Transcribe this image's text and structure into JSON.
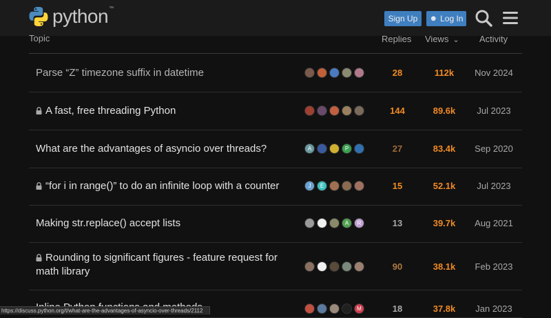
{
  "header": {
    "logo_text": "python",
    "logo_tm": "™",
    "signup_label": "Sign Up",
    "login_label": "Log In"
  },
  "columns": {
    "topic": "Topic",
    "replies": "Replies",
    "views": "Views",
    "activity": "Activity"
  },
  "topics": [
    {
      "title": "Parse “Z” timezone suffix in datetime",
      "locked": false,
      "muted": true,
      "replies": "28",
      "views": "112k",
      "activity": "Nov 2024",
      "replies_color": "#f08a24",
      "views_color": "#f08a24"
    },
    {
      "title": "A fast, free threading Python",
      "locked": true,
      "muted": false,
      "replies": "144",
      "views": "89.6k",
      "activity": "Jul 2023",
      "replies_color": "#f08a24",
      "views_color": "#f08a24"
    },
    {
      "title": "What are the advantages of asyncio over threads?",
      "locked": false,
      "muted": false,
      "replies": "27",
      "views": "83.4k",
      "activity": "Sep 2020",
      "replies_color": "#a06a38",
      "views_color": "#f08a24"
    },
    {
      "title": "“for i in range()” to do an infinite loop with a counter",
      "locked": true,
      "muted": false,
      "replies": "15",
      "views": "52.1k",
      "activity": "Jul 2023",
      "replies_color": "#f08a24",
      "views_color": "#f08a24"
    },
    {
      "title": "Making str.replace() accept lists",
      "locked": false,
      "muted": false,
      "replies": "13",
      "views": "39.7k",
      "activity": "Aug 2021",
      "replies_color": "#a8a8a8",
      "views_color": "#f08a24"
    },
    {
      "title": "Rounding to significant figures - feature request for math library",
      "locked": true,
      "muted": false,
      "replies": "90",
      "views": "38.1k",
      "activity": "Feb 2023",
      "replies_color": "#b07a40",
      "views_color": "#f08a24"
    },
    {
      "title": "Inline Python functions and methods",
      "locked": false,
      "muted": false,
      "replies": "18",
      "views": "37.8k",
      "activity": "Jan 2023",
      "replies_color": "#a8a8a8",
      "views_color": "#f08a24"
    }
  ],
  "status_url": "https://discuss.python.org/t/what-are-the-advantages-of-asyncio-over-threads/2112",
  "colors": {
    "accent_orange": "#f08a24",
    "button_blue": "#3f7fbf",
    "header_bg": "#1b1b1b",
    "page_bg": "#111111"
  }
}
